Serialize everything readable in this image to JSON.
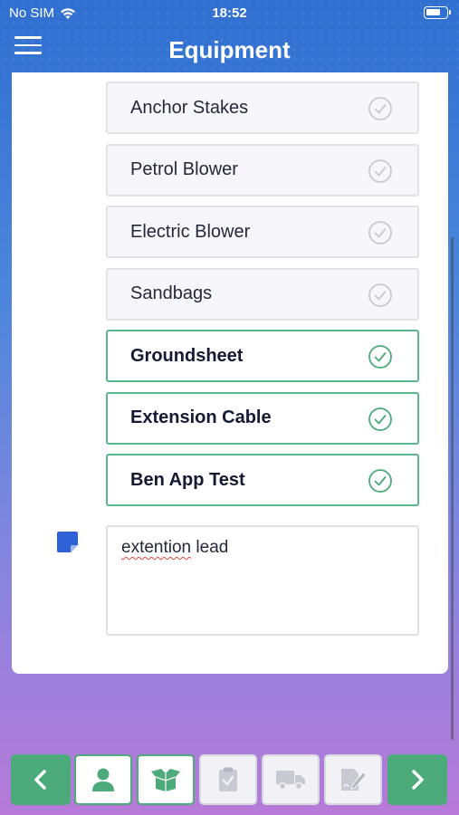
{
  "status_bar": {
    "carrier": "No SIM",
    "time": "18:52"
  },
  "header": {
    "title": "Equipment"
  },
  "equipment_items": [
    {
      "label": "Anchor Stakes",
      "checked": false
    },
    {
      "label": "Petrol Blower",
      "checked": false
    },
    {
      "label": "Electric Blower",
      "checked": false
    },
    {
      "label": "Sandbags",
      "checked": false
    },
    {
      "label": "Groundsheet",
      "checked": true
    },
    {
      "label": "Extension Cable",
      "checked": true
    },
    {
      "label": "Ben App Test",
      "checked": true
    }
  ],
  "notes": {
    "value": "extention lead",
    "misspelled_word": "extention"
  },
  "colors": {
    "accent_green": "#4daa7b",
    "check_gray": "#c9c9cf",
    "note_blue": "#2f62d6"
  },
  "bottom_nav": {
    "items": [
      {
        "icon": "chevron-left-icon",
        "state": "active"
      },
      {
        "icon": "person-icon",
        "state": "active"
      },
      {
        "icon": "box-open-icon",
        "state": "active"
      },
      {
        "icon": "clipboard-check-icon",
        "state": "disabled"
      },
      {
        "icon": "truck-icon",
        "state": "disabled"
      },
      {
        "icon": "signature-document-icon",
        "state": "disabled"
      },
      {
        "icon": "chevron-right-icon",
        "state": "active"
      }
    ]
  }
}
